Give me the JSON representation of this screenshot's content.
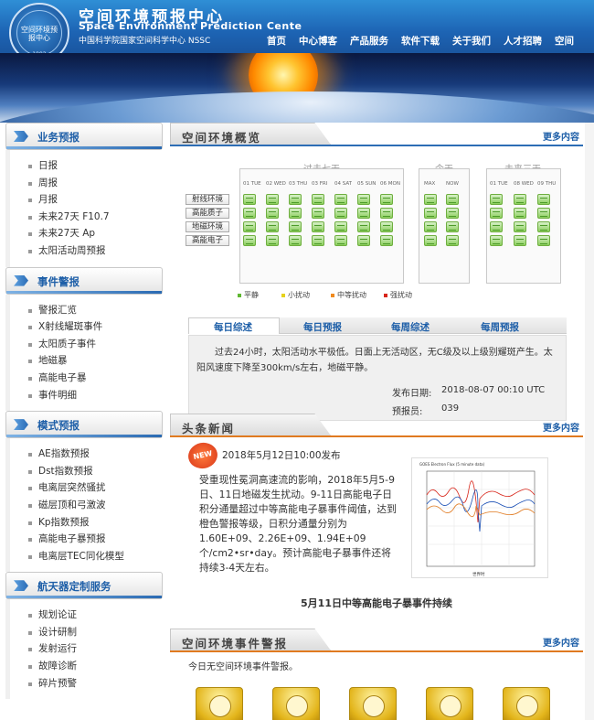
{
  "header": {
    "title_cn": "空间环境预报中心",
    "title_en": "Space Environment Prediction Cente",
    "subtitle": "中国科学院国家空间科学中心 NSSC",
    "logo_text": "空间环境预报中心",
    "logo_year": "1992",
    "nav": [
      "首页",
      "中心博客",
      "产品服务",
      "软件下载",
      "关于我们",
      "人才招聘",
      "空间"
    ]
  },
  "sidebar": {
    "sections": [
      {
        "title": "业务预报",
        "items": [
          "日报",
          "周报",
          "月报",
          "未来27天 F10.7",
          "未来27天 Ap",
          "太阳活动周预报"
        ]
      },
      {
        "title": "事件警报",
        "items": [
          "警报汇览",
          "X射线耀斑事件",
          "太阳质子事件",
          "地磁暴",
          "高能电子暴",
          "事件明细"
        ]
      },
      {
        "title": "模式预报",
        "items": [
          "AE指数预报",
          "Dst指数预报",
          "电离层突然骚扰",
          "磁层顶和弓激波",
          "Kp指数预报",
          "高能电子暴预报",
          "电离层TEC同化模型"
        ]
      },
      {
        "title": "航天器定制服务",
        "items": [
          "规划论证",
          "设计研制",
          "发射运行",
          "故障诊断",
          "碎片预警"
        ]
      }
    ]
  },
  "overview": {
    "title": "空间环境概览",
    "more": "更多内容",
    "groups": {
      "past": "过去七天",
      "today": "今天",
      "future": "未来三天"
    },
    "past_days": [
      "01 TUE",
      "02 WED",
      "03 THU",
      "03 FRI",
      "04 SAT",
      "05 SUN",
      "06 MON"
    ],
    "today_days": [
      "MAX",
      "NOW"
    ],
    "future_days": [
      "01 TUE",
      "08 WED",
      "09 THU"
    ],
    "rows": [
      "射线环境",
      "高能质子",
      "地磁环境",
      "高能电子"
    ],
    "legend": [
      {
        "label": "平静",
        "color": "#5fb832"
      },
      {
        "label": "小扰动",
        "color": "#e6d21c"
      },
      {
        "label": "中等扰动",
        "color": "#f08a1e"
      },
      {
        "label": "强扰动",
        "color": "#d8261a"
      }
    ],
    "tabs": [
      "每日综述",
      "每日预报",
      "每周综述",
      "每周预报"
    ],
    "summary": "过去24小时，太阳活动水平极低。日面上无活动区，无C级及以上级别耀斑产生。太阳风速度下降至300km/s左右，地磁平静。",
    "publish_label": "发布日期:",
    "publish_date": "2018-08-07 00:10 UTC",
    "forecaster_label": "预报员:",
    "forecaster": "039"
  },
  "news": {
    "title": "头条新闻",
    "more": "更多内容",
    "badge": "NEW",
    "date": "2018年5月12日10:00发布",
    "body": "受重现性冕洞高速流的影响，2018年5月5-9日、11日地磁发生扰动。9-11日高能电子日积分通量超过中等高能电子暴事件阈值，达到橙色警报等级，日积分通量分别为1.60E+09、2.26E+09、1.94E+09个/cm2•sr•day。预计高能电子暴事件还将持续3-4天左右。",
    "headline": "5月11日中等高能电子暴事件持续",
    "plot_title": "GOES Electron Flux (5 minute data)",
    "plot_xlabel": "世界时"
  },
  "alerts": {
    "title": "空间环境事件警报",
    "more": "更多内容",
    "text": "今日无空间环境事件警报。"
  }
}
